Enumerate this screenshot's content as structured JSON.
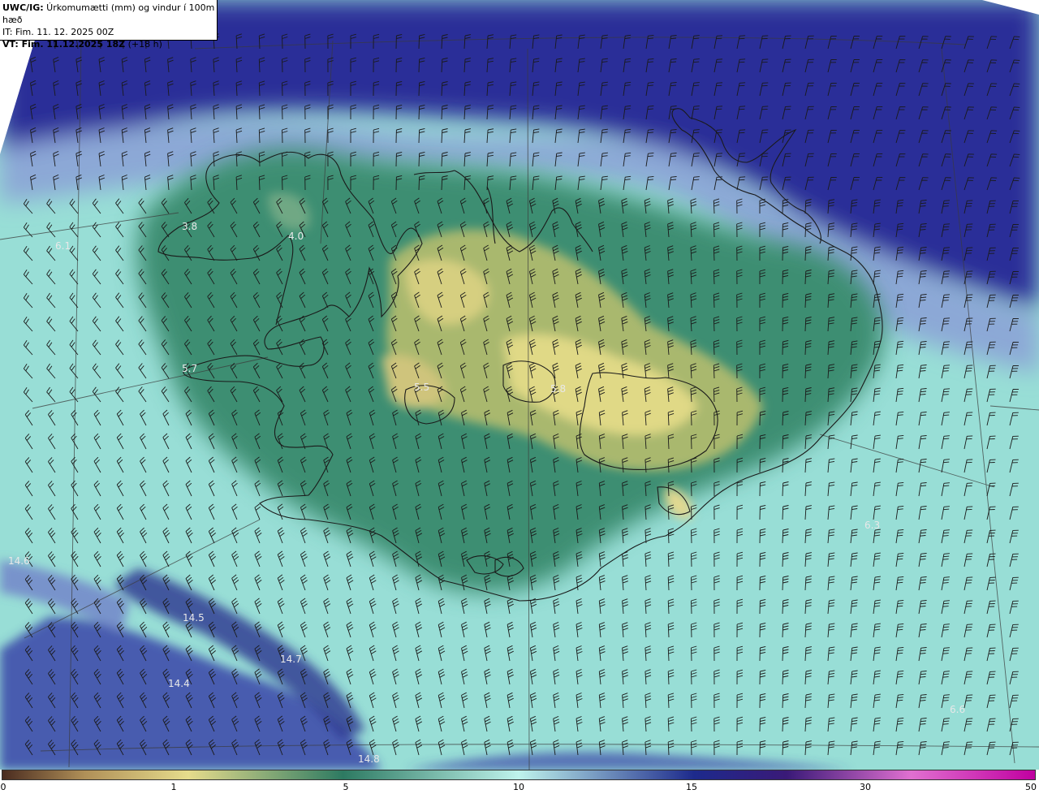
{
  "header": {
    "line1_bold": "UWC/IG:",
    "line1_rest": " Úrkomumætti (mm) og vindur í 100m hæð",
    "line2": "IT: Fim. 11. 12. 2025 00Z",
    "line3_bold": "VT: Fim. 11.12.2025 18Z",
    "line3_rest": " (+18 h)"
  },
  "colorbar": {
    "ticks": [
      "0",
      "1",
      "5",
      "10",
      "15",
      "30",
      "50"
    ],
    "colors": [
      "#4a2c20",
      "#b09058",
      "#e6dc8c",
      "#2d7a62",
      "#bff3ec",
      "#1d2a8c",
      "#3a1a78",
      "#e070d0",
      "#c000a0"
    ]
  },
  "map": {
    "land_color": "#d8c878",
    "sea_color": "#9ee6de",
    "deep_color": "#1e2290",
    "labels": [
      {
        "id": "wf-1",
        "text": "3.8"
      },
      {
        "id": "wf-2",
        "text": "4.0"
      },
      {
        "id": "wf-3",
        "text": "6.1"
      },
      {
        "id": "wf-4",
        "text": "5.7"
      },
      {
        "id": "wf-5",
        "text": "5.5"
      },
      {
        "id": "wf-6",
        "text": "5.8"
      },
      {
        "id": "wf-7",
        "text": "6.3"
      },
      {
        "id": "wf-8",
        "text": "14.6"
      },
      {
        "id": "wf-9",
        "text": "14.5"
      },
      {
        "id": "wf-10",
        "text": "14.7"
      },
      {
        "id": "wf-11",
        "text": "14.4"
      },
      {
        "id": "wf-12",
        "text": "6.6"
      },
      {
        "id": "wf-13",
        "text": "14.8"
      }
    ]
  }
}
